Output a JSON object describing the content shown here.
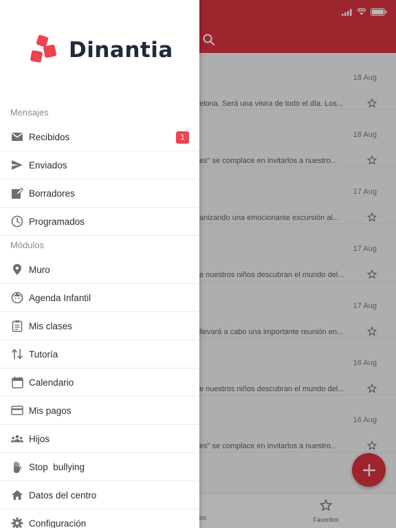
{
  "app": {
    "messages": [
      {
        "date": "18 Aug",
        "preview": "elona. Será una visira de todo el día. Los..."
      },
      {
        "date": "18 Aug",
        "preview": "es\" se complace en invitarlos a nuestro..."
      },
      {
        "date": "17 Aug",
        "preview": "anizando una emocionante excursión al..."
      },
      {
        "date": "17 Aug",
        "preview": "e nuestros niños descubran el mundo del..."
      },
      {
        "date": "17 Aug",
        "preview": "llevará a cabo una importante reunión en..."
      },
      {
        "date": "16 Aug",
        "preview": "e nuestros niños descubran el mundo del..."
      },
      {
        "date": "16 Aug",
        "preview": "es\" se complace en invitarlos a nuestro..."
      }
    ],
    "tabs": {
      "other_label": "idos",
      "favorites_label": "Favoritos"
    },
    "colors": {
      "brand": "#dc3341",
      "badge": "#f04350"
    }
  },
  "drawer": {
    "logo_text": "Dinantia",
    "sections": {
      "messages_title": "Mensajes",
      "modules_title": "Módulos"
    },
    "message_items": [
      {
        "label": "Recibidos",
        "icon": "mail-icon",
        "badge": "1"
      },
      {
        "label": "Enviados",
        "icon": "send-icon"
      },
      {
        "label": "Borradores",
        "icon": "edit-icon"
      },
      {
        "label": "Programados",
        "icon": "clock-icon"
      }
    ],
    "module_items": [
      {
        "label": "Muro",
        "icon": "location-pin-icon"
      },
      {
        "label": "Agenda Infantil",
        "icon": "child-face-icon"
      },
      {
        "label": "Mis clases",
        "icon": "clipboard-icon"
      },
      {
        "label": "Tutoría",
        "icon": "swap-vertical-icon"
      },
      {
        "label": "Calendario",
        "icon": "calendar-icon"
      },
      {
        "label": "Mis pagos",
        "icon": "credit-card-icon"
      },
      {
        "label": "Hijos",
        "icon": "people-icon"
      },
      {
        "label": "Stop  bullying",
        "icon": "hand-icon"
      },
      {
        "label": "Datos del centro",
        "icon": "home-icon"
      },
      {
        "label": "Configuración",
        "icon": "gear-icon"
      }
    ]
  }
}
